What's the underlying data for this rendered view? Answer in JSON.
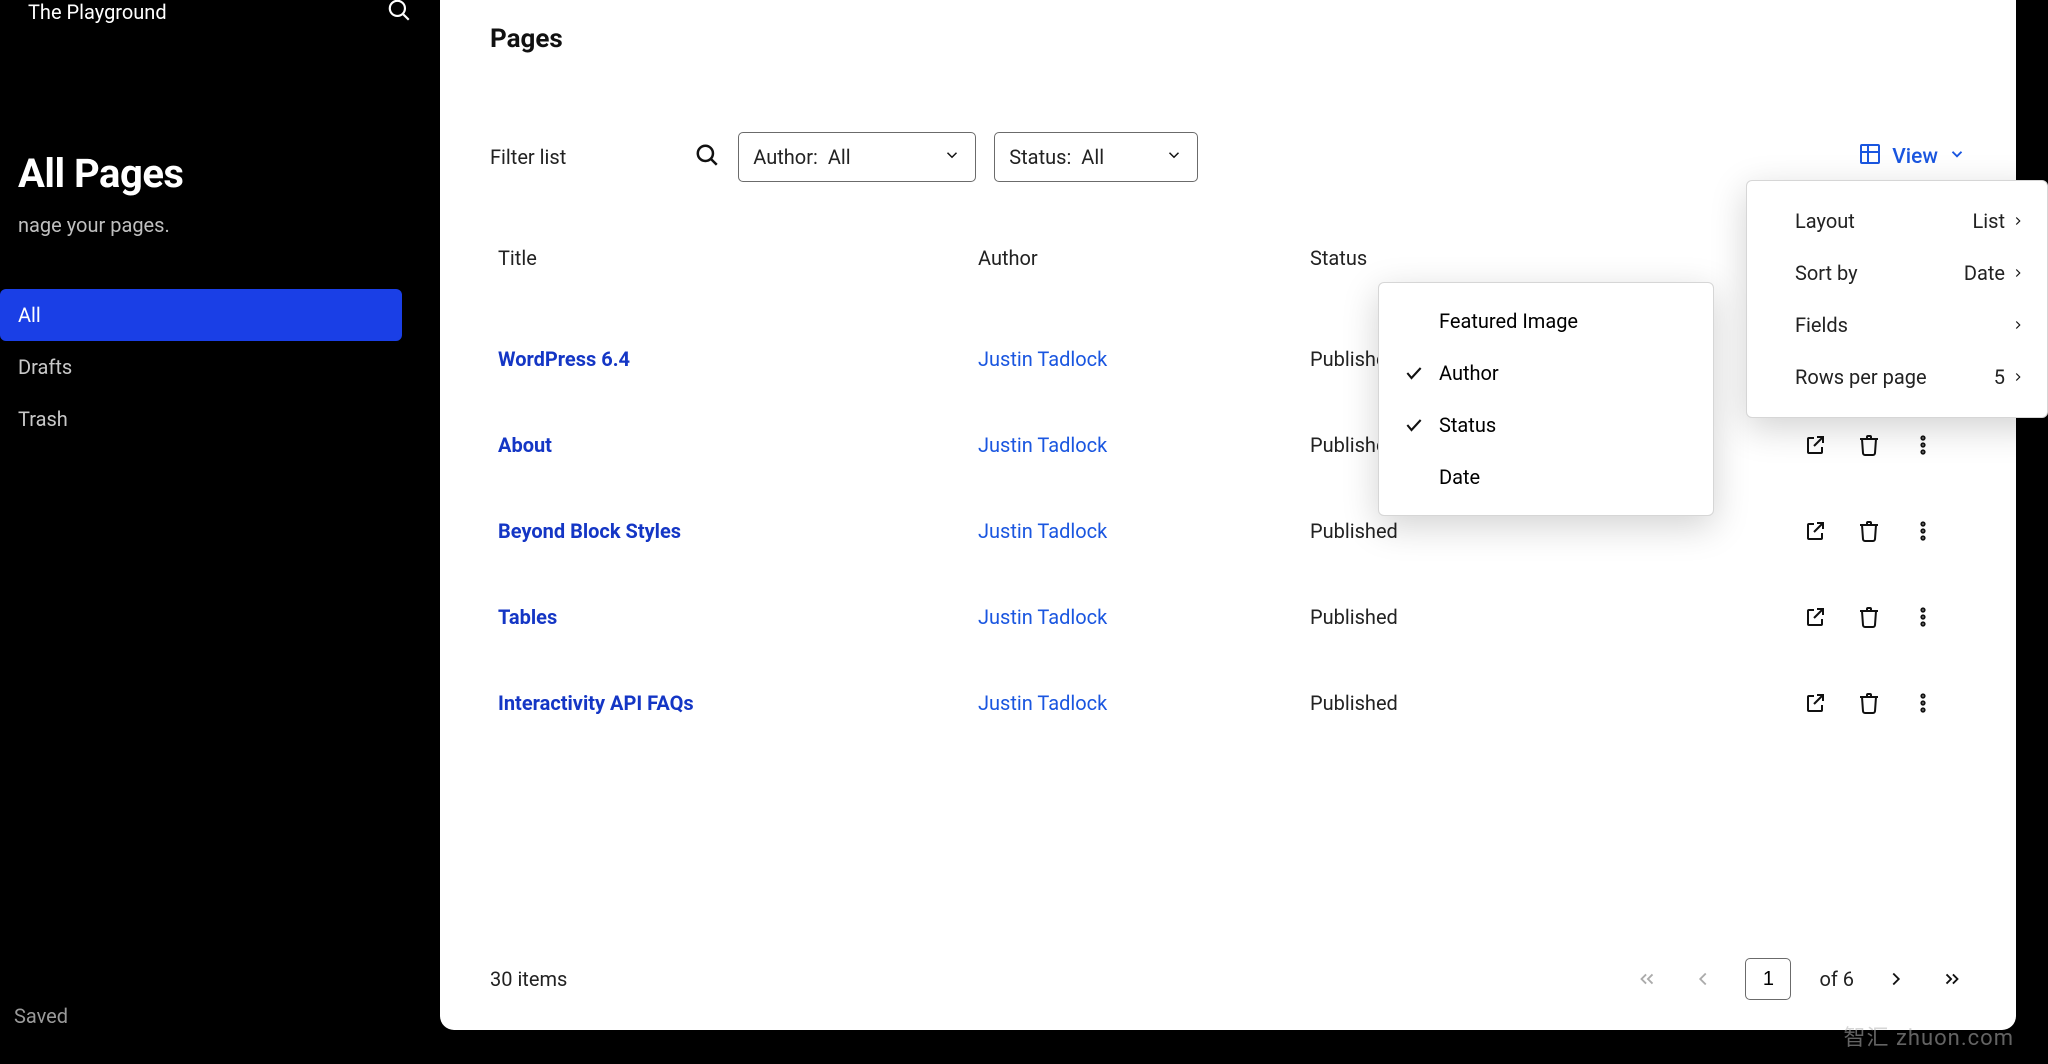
{
  "sidebar": {
    "site_title": "The Playground",
    "heading": "All Pages",
    "subheading": "nage your pages.",
    "nav": [
      {
        "label": "All",
        "active": true
      },
      {
        "label": "Drafts",
        "active": false
      },
      {
        "label": "Trash",
        "active": false
      }
    ],
    "saved": "Saved"
  },
  "panel": {
    "title": "Pages",
    "filter_label": "Filter list",
    "author_filter": {
      "label": "Author:",
      "value": "All"
    },
    "status_filter": {
      "label": "Status:",
      "value": "All"
    },
    "view_label": "View",
    "columns": {
      "title": "Title",
      "author": "Author",
      "status": "Status"
    },
    "rows": [
      {
        "title": "WordPress 6.4",
        "author": "Justin Tadlock",
        "status": "Published"
      },
      {
        "title": "About",
        "author": "Justin Tadlock",
        "status": "Published"
      },
      {
        "title": "Beyond Block Styles",
        "author": "Justin Tadlock",
        "status": "Published"
      },
      {
        "title": "Tables",
        "author": "Justin Tadlock",
        "status": "Published"
      },
      {
        "title": "Interactivity API FAQs",
        "author": "Justin Tadlock",
        "status": "Published"
      }
    ],
    "items_count": "30 items",
    "page_current": "1",
    "page_of": "of 6"
  },
  "view_popover": {
    "layout": {
      "label": "Layout",
      "value": "List"
    },
    "sort": {
      "label": "Sort by",
      "value": "Date"
    },
    "fields": {
      "label": "Fields",
      "value": ""
    },
    "rows": {
      "label": "Rows per page",
      "value": "5"
    }
  },
  "fields_popover": {
    "items": [
      {
        "label": "Featured Image",
        "checked": false
      },
      {
        "label": "Author",
        "checked": true
      },
      {
        "label": "Status",
        "checked": true
      },
      {
        "label": "Date",
        "checked": false
      }
    ]
  },
  "watermark": "智汇 zhuon.com"
}
